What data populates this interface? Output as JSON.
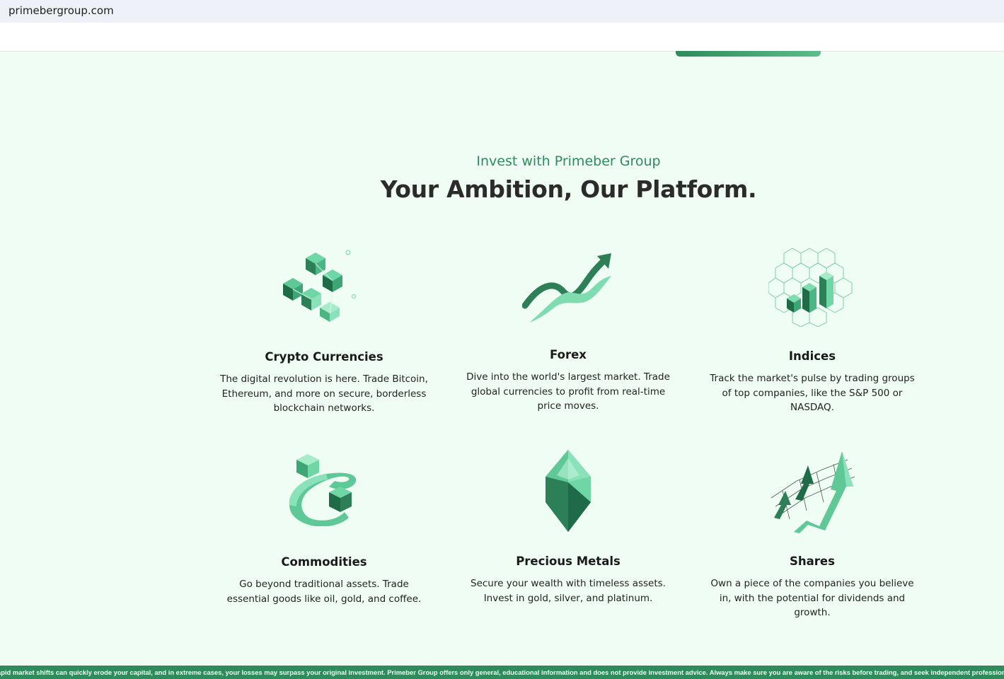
{
  "browser": {
    "url": "primebergroup.com"
  },
  "hero": {
    "eyebrow": "Invest with Primeber Group",
    "headline": "Your Ambition, Our Platform."
  },
  "cards": [
    {
      "title": "Crypto Currencies",
      "desc": "The digital revolution is here. Trade Bitcoin, Ethereum, and more on secure, borderless blockchain networks.",
      "icon": "crypto-cubes-icon"
    },
    {
      "title": "Forex",
      "desc": "Dive into the world's largest market. Trade global currencies to profit from real-time price moves.",
      "icon": "forex-trend-icon"
    },
    {
      "title": "Indices",
      "desc": "Track the market's pulse by trading groups of top companies, like the S&P 500 or NASDAQ.",
      "icon": "indices-chart-icon"
    },
    {
      "title": "Commodities",
      "desc": "Go beyond traditional assets. Trade essential goods like oil, gold, and coffee.",
      "icon": "commodities-cube-icon"
    },
    {
      "title": "Precious Metals",
      "desc": "Secure your wealth with timeless assets. Invest in gold, silver, and platinum.",
      "icon": "gem-icon"
    },
    {
      "title": "Shares",
      "desc": "Own a piece of the companies you believe in, with the potential for dividends and growth.",
      "icon": "shares-arrows-icon"
    }
  ],
  "disclaimer": "apid market shifts can quickly erode your capital, and in extreme cases, your losses may surpass your original investment. Primeber Group offers only general, educational information and does not provide investment advice. Always make sure you are aware of the risks before trading, and seek independent professional guidance if you",
  "colors": {
    "accent": "#2f8a5c",
    "background": "#effdf5",
    "heading": "#2b2b2b"
  }
}
